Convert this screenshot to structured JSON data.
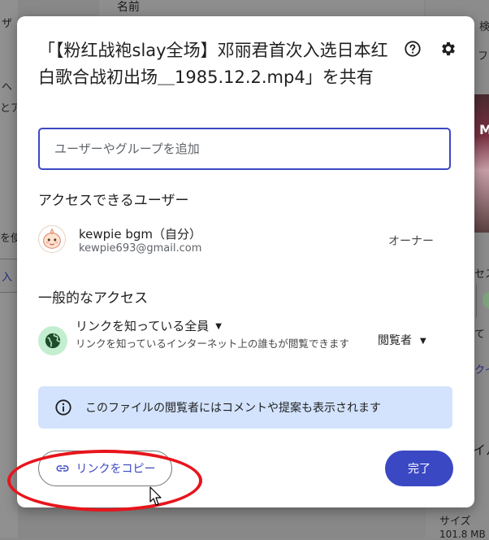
{
  "background": {
    "column_header": "名前",
    "left_fragments": [
      "ザ",
      "へ",
      "とア",
      "を使",
      "入"
    ],
    "right_fragments": [
      "検",
      "ファ",
      "M",
      "セス",
      "て",
      "クイ",
      "イル"
    ],
    "size_label": "サイズ",
    "size_value": "101.8 MB"
  },
  "dialog": {
    "title": "「【粉红战袍slay全场】邓丽君首次入选日本红白歌合战初出场＿1985.12.2.mp4」を共有",
    "help_icon": "help-circle-icon",
    "settings_icon": "gear-icon",
    "share_input": {
      "value": "",
      "placeholder": "ユーザーやグループを追加"
    },
    "people_heading": "アクセスできるユーザー",
    "people": [
      {
        "name": "kewpie bgm（自分）",
        "email": "kewpie693@gmail.com",
        "role": "オーナー"
      }
    ],
    "general_heading": "一般的なアクセス",
    "general_access": {
      "setting": "リンクを知っている全員",
      "description": "リンクを知っているインターネット上の誰もが閲覧できます",
      "role": "閲覧者"
    },
    "info_text": "このファイルの閲覧者にはコメントや提案も表示されます",
    "copy_link_label": "リンクをコピー",
    "done_label": "完了"
  },
  "colors": {
    "accent": "#3b48c4",
    "info_bg": "#d3e3fd",
    "globe_bg": "#c4eed0",
    "annotation": "#e8141c"
  }
}
